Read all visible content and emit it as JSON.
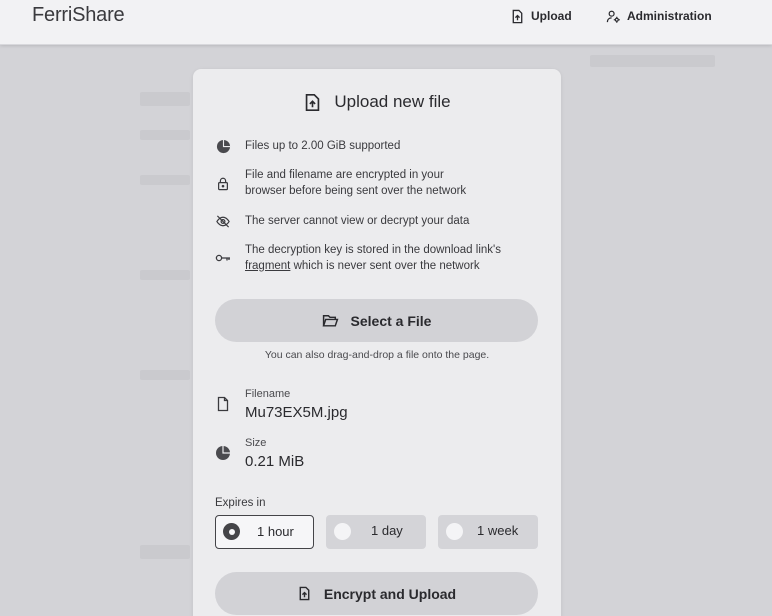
{
  "header": {
    "brand": "FerriShare",
    "nav": {
      "upload_label": "Upload",
      "admin_label": "Administration"
    }
  },
  "card": {
    "title": "Upload new file",
    "features": [
      {
        "icon": "pie-chart-icon",
        "text": "Files up to 2.00 GiB supported"
      },
      {
        "icon": "lock-icon",
        "line1": "File and filename are encrypted in your",
        "line2": "browser before being sent over the network"
      },
      {
        "icon": "eye-off-icon",
        "text": "The server cannot view or decrypt your data"
      },
      {
        "icon": "key-icon",
        "line1": "The decryption key is stored in the download link's",
        "link": "fragment",
        "line2_rest": " which is never sent over the network"
      }
    ],
    "select_button_label": "Select a File",
    "drag_hint": "You can also drag-and-drop a file onto the page.",
    "file": {
      "filename_label": "Filename",
      "filename_value": "Mu73EX5M.jpg",
      "size_label": "Size",
      "size_value": "0.21 MiB"
    },
    "expires": {
      "label": "Expires in",
      "options": [
        "1 hour",
        "1 day",
        "1 week"
      ],
      "selected": "1 hour"
    },
    "encrypt_button_label": "Encrypt and Upload"
  },
  "colors": {
    "background": "#d3d3d7",
    "card": "#ececee",
    "button": "#d2d2d6",
    "text": "#2a2a2e"
  }
}
